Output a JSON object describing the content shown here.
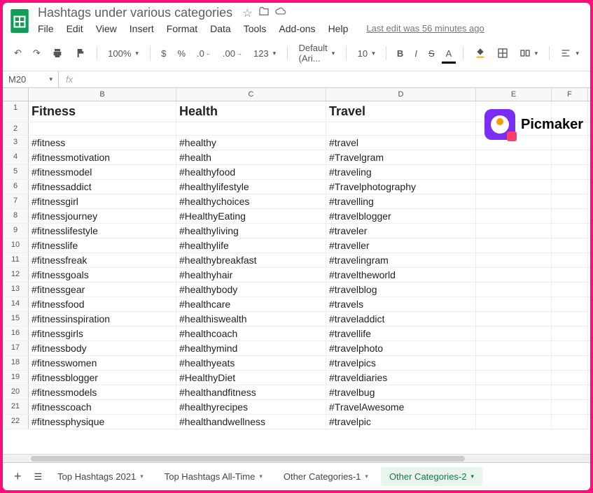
{
  "doc": {
    "title": "Hashtags under various categories",
    "last_edit": "Last edit was 56 minutes ago"
  },
  "menus": [
    "File",
    "Edit",
    "View",
    "Insert",
    "Format",
    "Data",
    "Tools",
    "Add-ons",
    "Help"
  ],
  "toolbar": {
    "zoom": "100%",
    "currency": "$",
    "percent": "%",
    "dec_less": ".0",
    "dec_more": ".00",
    "num_format": "123",
    "font": "Default (Ari...",
    "font_size": "10",
    "bold": "B",
    "italic": "I",
    "strike": "S",
    "text_color": "A"
  },
  "namebox": "M20",
  "fx_placeholder": "fx",
  "columns": [
    "B",
    "C",
    "D",
    "E",
    "F"
  ],
  "picmaker": "Picmaker",
  "chart_data": {
    "type": "table",
    "title": "Hashtags under various categories",
    "categories": [
      "Fitness",
      "Health",
      "Travel"
    ],
    "series": [
      {
        "name": "Fitness",
        "values": [
          "#fitness",
          "#fitnessmotivation",
          "#fitnessmodel",
          "#fitnessaddict",
          "#fitnessgirl",
          "#fitnessjourney",
          "#fitnesslifestyle",
          "#fitnesslife",
          "#fitnessfreak",
          "#fitnessgoals",
          "#fitnessgear",
          "#fitnessfood",
          "#fitnessinspiration",
          "#fitnessgirls",
          "#fitnessbody",
          "#fitnesswomen",
          "#fitnessblogger",
          "#fitnessmodels",
          "#fitnesscoach",
          "#fitnessphysique"
        ]
      },
      {
        "name": "Health",
        "values": [
          "#healthy",
          "#health",
          "#healthyfood",
          "#healthylifestyle",
          "#healthychoices",
          "#HealthyEating",
          "#healthyliving",
          "#healthylife",
          "#healthybreakfast",
          "#healthyhair",
          "#healthybody",
          "#healthcare",
          "#healthiswealth",
          "#healthcoach",
          "#healthymind",
          "#healthyeats",
          "#HealthyDiet",
          "#healthandfitness",
          "#healthyrecipes",
          "#healthandwellness"
        ]
      },
      {
        "name": "Travel",
        "values": [
          "#travel",
          "#Travelgram",
          "#traveling",
          "#Travelphotography",
          "#travelling",
          "#travelblogger",
          "#traveler",
          "#traveller",
          "#travelingram",
          "#traveltheworld",
          "#travelblog",
          "#travels",
          "#traveladdict",
          "#travellife",
          "#travelphoto",
          "#travelpics",
          "#traveldiaries",
          "#travelbug",
          "#TravelAwesome",
          "#travelpic"
        ]
      }
    ]
  },
  "rows": [
    {
      "n": "1",
      "b": "Fitness",
      "c": "Health",
      "d": "Travel"
    },
    {
      "n": "2",
      "b": "",
      "c": "",
      "d": ""
    },
    {
      "n": "3",
      "b": "#fitness",
      "c": "#healthy",
      "d": "#travel"
    },
    {
      "n": "4",
      "b": "#fitnessmotivation",
      "c": "#health",
      "d": "#Travelgram"
    },
    {
      "n": "5",
      "b": "#fitnessmodel",
      "c": "#healthyfood",
      "d": "#traveling"
    },
    {
      "n": "6",
      "b": "#fitnessaddict",
      "c": "#healthylifestyle",
      "d": "#Travelphotography"
    },
    {
      "n": "7",
      "b": "#fitnessgirl",
      "c": "#healthychoices",
      "d": "#travelling"
    },
    {
      "n": "8",
      "b": "#fitnessjourney",
      "c": "#HealthyEating",
      "d": "#travelblogger"
    },
    {
      "n": "9",
      "b": "#fitnesslifestyle",
      "c": "#healthyliving",
      "d": "#traveler"
    },
    {
      "n": "10",
      "b": "#fitnesslife",
      "c": "#healthylife",
      "d": "#traveller"
    },
    {
      "n": "11",
      "b": "#fitnessfreak",
      "c": "#healthybreakfast",
      "d": "#travelingram"
    },
    {
      "n": "12",
      "b": "#fitnessgoals",
      "c": "#healthyhair",
      "d": "#traveltheworld"
    },
    {
      "n": "13",
      "b": "#fitnessgear",
      "c": "#healthybody",
      "d": "#travelblog"
    },
    {
      "n": "14",
      "b": "#fitnessfood",
      "c": "#healthcare",
      "d": "#travels"
    },
    {
      "n": "15",
      "b": "#fitnessinspiration",
      "c": "#healthiswealth",
      "d": "#traveladdict"
    },
    {
      "n": "16",
      "b": "#fitnessgirls",
      "c": "#healthcoach",
      "d": "#travellife"
    },
    {
      "n": "17",
      "b": "#fitnessbody",
      "c": "#healthymind",
      "d": "#travelphoto"
    },
    {
      "n": "18",
      "b": "#fitnesswomen",
      "c": "#healthyeats",
      "d": "#travelpics"
    },
    {
      "n": "19",
      "b": "#fitnessblogger",
      "c": "#HealthyDiet",
      "d": "#traveldiaries"
    },
    {
      "n": "20",
      "b": "#fitnessmodels",
      "c": "#healthandfitness",
      "d": "#travelbug"
    },
    {
      "n": "21",
      "b": "#fitnesscoach",
      "c": "#healthyrecipes",
      "d": "#TravelAwesome"
    },
    {
      "n": "22",
      "b": "#fitnessphysique",
      "c": "#healthandwellness",
      "d": "#travelpic"
    }
  ],
  "tabs": [
    {
      "label": "Top Hashtags 2021",
      "active": false
    },
    {
      "label": "Top Hashtags All-Time",
      "active": false
    },
    {
      "label": "Other Categories-1",
      "active": false
    },
    {
      "label": "Other Categories-2",
      "active": true
    }
  ]
}
